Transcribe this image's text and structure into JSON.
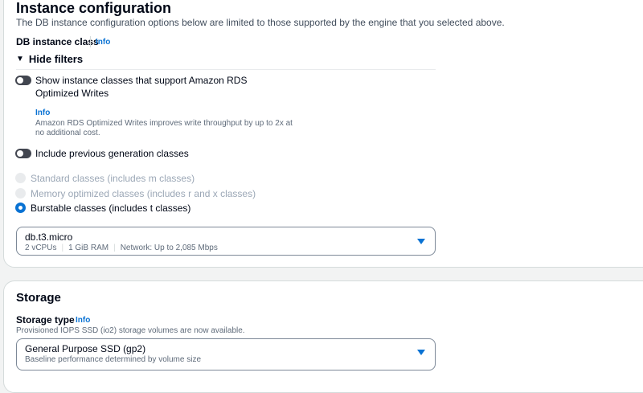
{
  "instance": {
    "title": "Instance configuration",
    "description": "The DB instance configuration options below are limited to those supported by the engine that you selected above.",
    "class_label": "DB instance class",
    "info": "Info",
    "hide_filters": "Hide filters",
    "toggle_optimized": "Show instance classes that support Amazon RDS Optimized Writes",
    "optimized_info": "Info",
    "optimized_desc": "Amazon RDS Optimized Writes improves write throughput by up to 2x at no additional cost.",
    "toggle_previous": "Include previous generation classes",
    "radios": [
      {
        "label": "Standard classes (includes m classes)",
        "selected": false,
        "disabled": true
      },
      {
        "label": "Memory optimized classes (includes r and x classes)",
        "selected": false,
        "disabled": true
      },
      {
        "label": "Burstable classes (includes t classes)",
        "selected": true,
        "disabled": false
      }
    ],
    "select": {
      "value": "db.t3.micro",
      "vcpu": "2 vCPUs",
      "ram": "1 GiB RAM",
      "network": "Network: Up to 2,085 Mbps"
    }
  },
  "storage": {
    "title": "Storage",
    "type_label": "Storage type",
    "info": "Info",
    "note": "Provisioned IOPS SSD (io2) storage volumes are now available.",
    "select": {
      "value": "General Purpose SSD (gp2)",
      "desc": "Baseline performance determined by volume size"
    }
  }
}
